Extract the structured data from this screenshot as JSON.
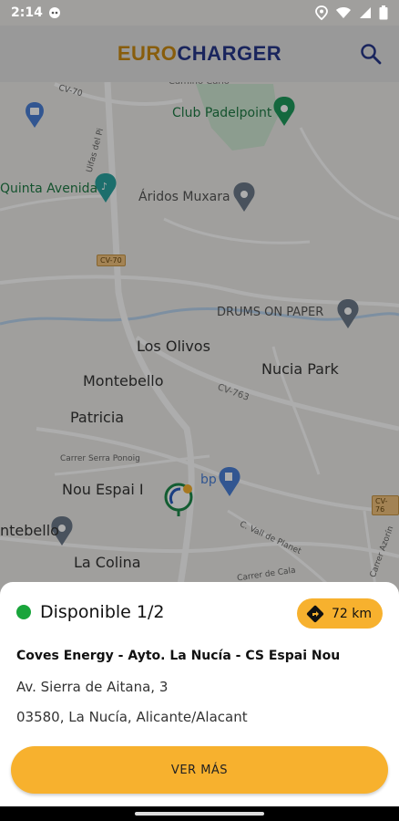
{
  "status_bar": {
    "time": "2:14"
  },
  "app": {
    "logo_part1": "EURO",
    "logo_part2": "CHARGER"
  },
  "map": {
    "labels": {
      "camino_cano": "Camino Cano",
      "club_padelpoint": "Club Padelpoint",
      "cv70_top": "CV-70",
      "quinta_avenida": "Quinta Avenida",
      "aridos_muxara": "Áridos Muxara",
      "cv70_badge": "CV-70",
      "drums_on_paper": "DRUMS ON PAPER",
      "los_olivos": "Los Olivos",
      "montebello": "Montebello",
      "nucia_park": "Nucia Park",
      "cv763": "CV-763",
      "patricia": "Patricia",
      "carrer_serra": "Carrer Serra Ponoig",
      "nou_espai": "Nou Espai I",
      "bp": "bp",
      "montebello_left": "ntebello",
      "la_colina": "La Colina",
      "vall_de_planet": "C. Vall de Planet",
      "cv76_badge": "CV-76",
      "uifas_del_pi": "Uifas del Pi",
      "cami_calla": "Carrer de Cala",
      "azorin": "Carrer Azorín"
    }
  },
  "sheet": {
    "status": "Disponible 1/2",
    "distance": "72 km",
    "station_name": "Coves Energy - Ayto. La Nucía - CS Espai Nou",
    "address_line1": "Av. Sierra de Aitana, 3",
    "address_line2": "03580, La Nucía, Alicante/Alacant",
    "more_button": "VER MÁS"
  },
  "colors": {
    "accent": "#f7b12e",
    "available": "#19a53b",
    "brand_orange": "#c98a12",
    "brand_blue": "#27378a"
  }
}
